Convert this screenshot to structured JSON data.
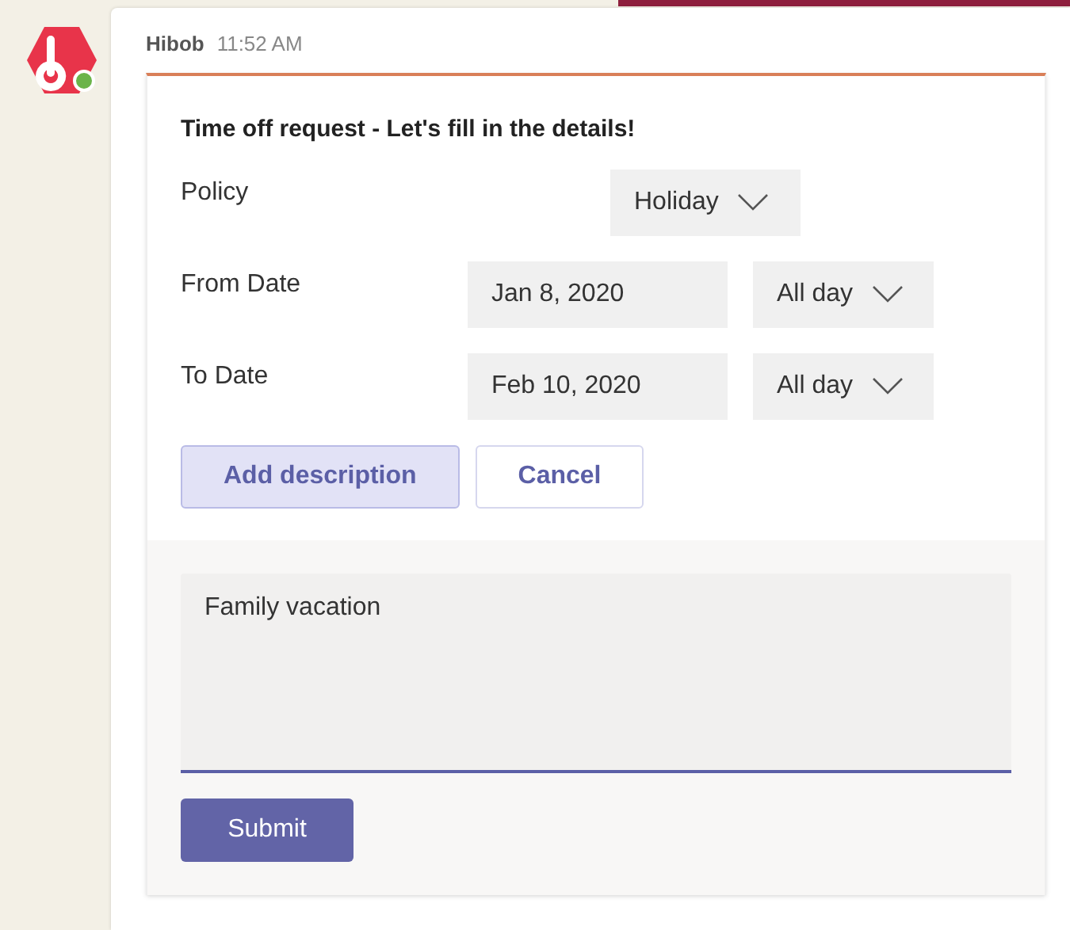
{
  "message": {
    "sender": "Hibob",
    "time": "11:52 AM",
    "online": true
  },
  "card": {
    "title": "Time off request - Let's fill in the details!",
    "rows": [
      {
        "label": "Policy",
        "controls": [
          {
            "kind": "dropdown",
            "value": "Holiday"
          }
        ]
      },
      {
        "label": "From Date",
        "controls": [
          {
            "kind": "date",
            "value": "Jan 8, 2020"
          },
          {
            "kind": "dropdown",
            "value": "All day"
          }
        ]
      },
      {
        "label": "To Date",
        "controls": [
          {
            "kind": "date",
            "value": "Feb 10, 2020"
          },
          {
            "kind": "dropdown",
            "value": "All day"
          }
        ]
      }
    ],
    "buttons": [
      {
        "label": "Add description",
        "selected": true
      },
      {
        "label": "Cancel",
        "selected": false
      }
    ],
    "description": {
      "value": "Family vacation"
    },
    "submit": "Submit"
  }
}
